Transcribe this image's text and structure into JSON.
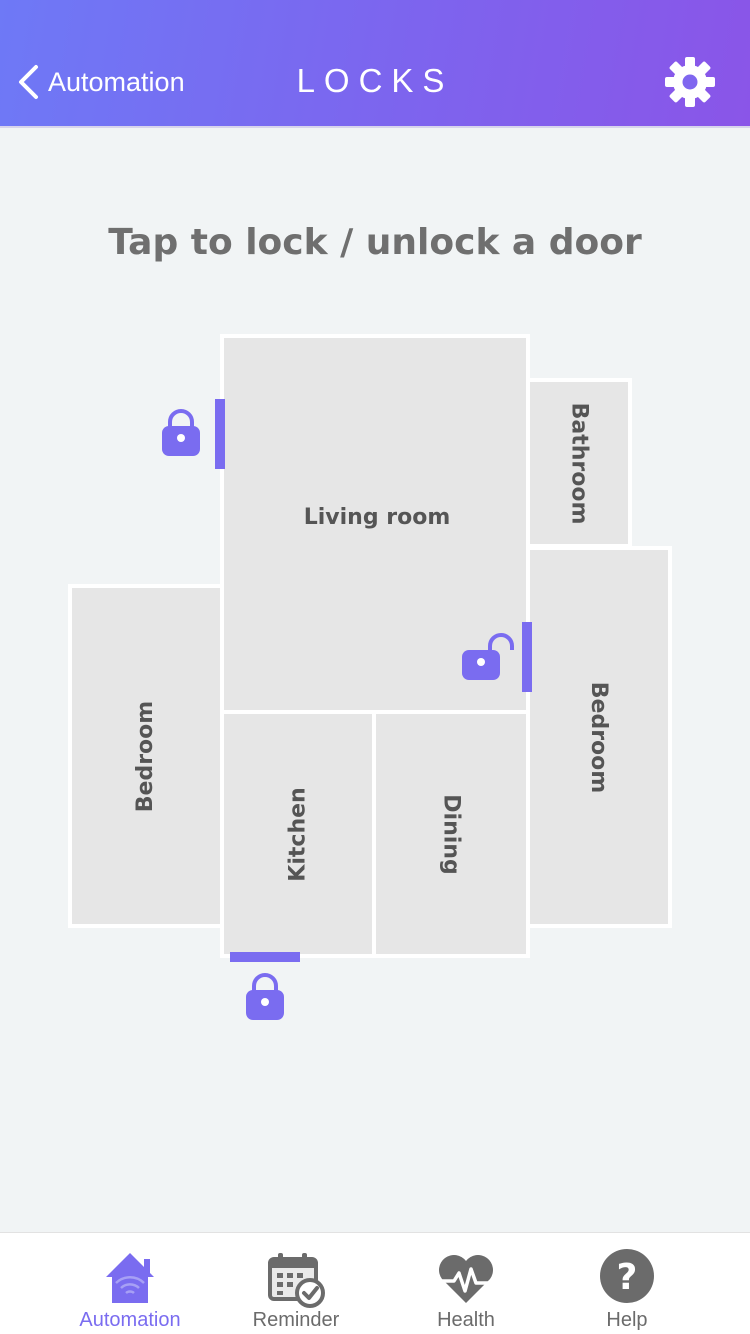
{
  "header": {
    "back_label": "Automation",
    "title": "LOCKS"
  },
  "instruction": "Tap to lock / unlock a door",
  "rooms": {
    "living_room": "Living room",
    "bathroom": "Bathroom",
    "bedroom_left": "Bedroom",
    "bedroom_right": "Bedroom",
    "kitchen": "Kitchen",
    "dining": "Dining"
  },
  "locks": {
    "front_door": "locked",
    "living_room_side_door": "unlocked",
    "kitchen_door": "locked"
  },
  "tabs": [
    {
      "label": "Automation",
      "icon": "home-wifi-icon",
      "active": true
    },
    {
      "label": "Reminder",
      "icon": "calendar-check-icon",
      "active": false
    },
    {
      "label": "Health",
      "icon": "heart-pulse-icon",
      "active": false
    },
    {
      "label": "Help",
      "icon": "help-icon",
      "active": false
    }
  ],
  "colors": {
    "accent": "#7a6cf0",
    "header_start": "#6e79f6",
    "header_end": "#8a55e8",
    "room_fill": "#e6e6e6",
    "background": "#f1f4f5"
  }
}
